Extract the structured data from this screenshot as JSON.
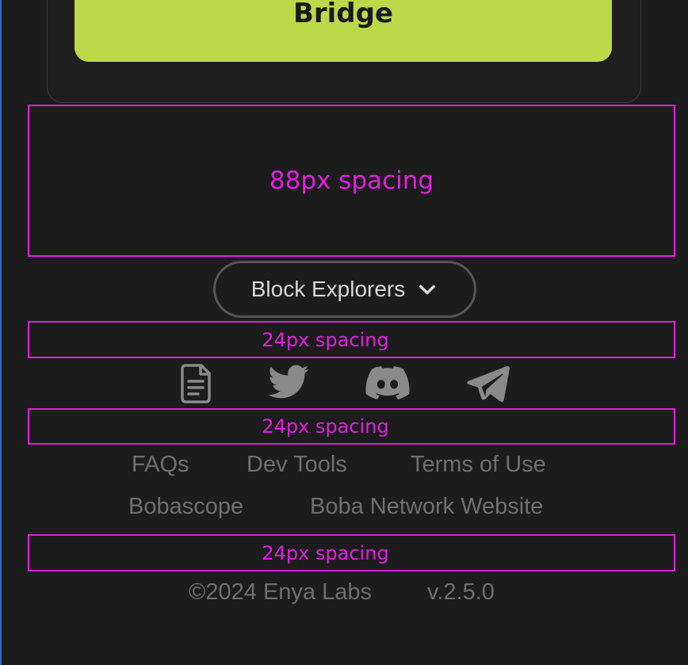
{
  "bridge_button": {
    "label": "Bridge"
  },
  "annotations": {
    "spacing_top": "88px spacing",
    "spacing_a": "24px spacing",
    "spacing_b": "24px spacing",
    "spacing_c": "24px spacing"
  },
  "block_explorers": {
    "label": "Block Explorers",
    "icon": "chevron-down-icon"
  },
  "social_icons": [
    "document-icon",
    "twitter-icon",
    "discord-icon",
    "telegram-icon"
  ],
  "links": {
    "faqs": "FAQs",
    "dev_tools": "Dev Tools",
    "terms": "Terms of Use",
    "bobascope": "Bobascope",
    "website": "Boba Network Website"
  },
  "footer": {
    "copyright": "©2024 Enya Labs",
    "version": "v.2.5.0"
  },
  "colors": {
    "accent": "#bcd94a",
    "background": "#1c1c1c",
    "annotation": "#e21ee2",
    "muted_text": "#6f6f6f"
  }
}
